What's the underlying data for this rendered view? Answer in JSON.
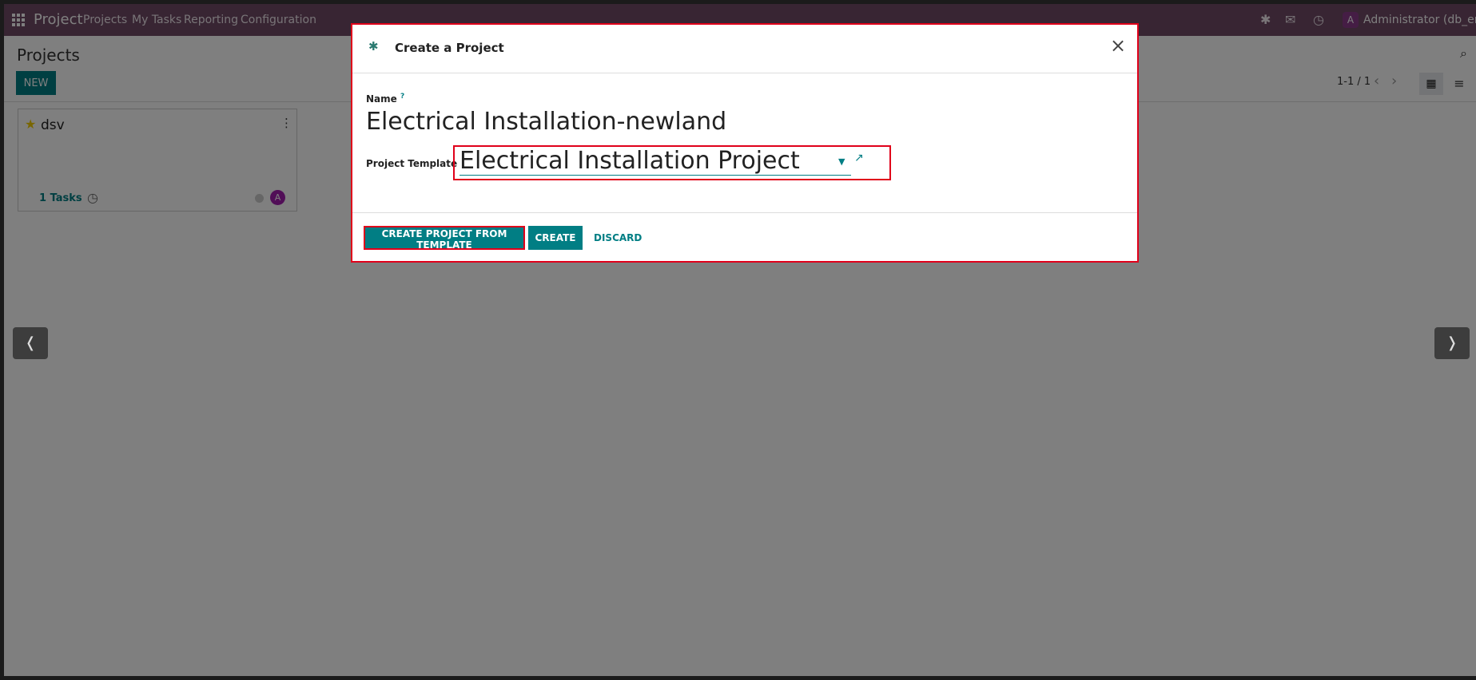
{
  "topbar": {
    "brand": "Project",
    "menu": [
      "Projects",
      "My Tasks",
      "Reporting",
      "Configuration"
    ],
    "user_initial": "A",
    "user_name": "Administrator (db_ente)"
  },
  "control": {
    "title": "Projects",
    "new_label": "NEW",
    "pager": "1-1 / 1"
  },
  "card": {
    "title": "dsv",
    "tasks": "1 Tasks",
    "avatar": "A"
  },
  "modal": {
    "title": "Create a Project",
    "name_label": "Name",
    "name_help": "?",
    "name_value": "Electrical Installation-newland",
    "template_label": "Project Template",
    "template_value": "Electrical Installation Project",
    "btn_template": "CREATE PROJECT FROM TEMPLATE",
    "btn_create": "CREATE",
    "btn_discard": "DISCARD"
  },
  "colors": {
    "topbar": "#714B67",
    "primary": "#017E84",
    "highlight": "#e0001a"
  },
  "icons": [
    "apps-grid-icon",
    "bug-icon",
    "chat-icon",
    "clock-icon",
    "search-icon",
    "kanban-view-icon",
    "list-view-icon",
    "star-icon",
    "more-icon",
    "close-icon",
    "caret-down-icon",
    "external-link-icon"
  ]
}
